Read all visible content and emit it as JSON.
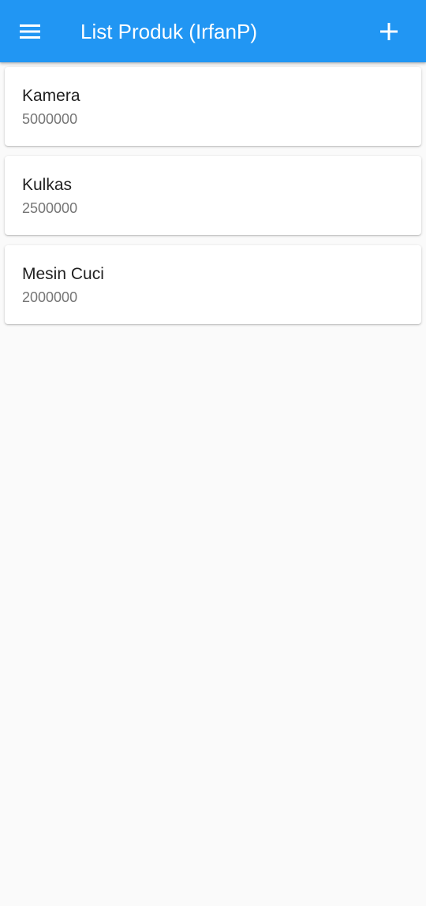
{
  "app_bar": {
    "title": "List Produk (IrfanP)",
    "background_color": "#2196f3",
    "menu_icon": "hamburger-menu-icon",
    "add_icon": "plus-icon"
  },
  "products": [
    {
      "name": "Kamera",
      "price": "5000000"
    },
    {
      "name": "Kulkas",
      "price": "2500000"
    },
    {
      "name": "Mesin Cuci",
      "price": "2000000"
    }
  ]
}
